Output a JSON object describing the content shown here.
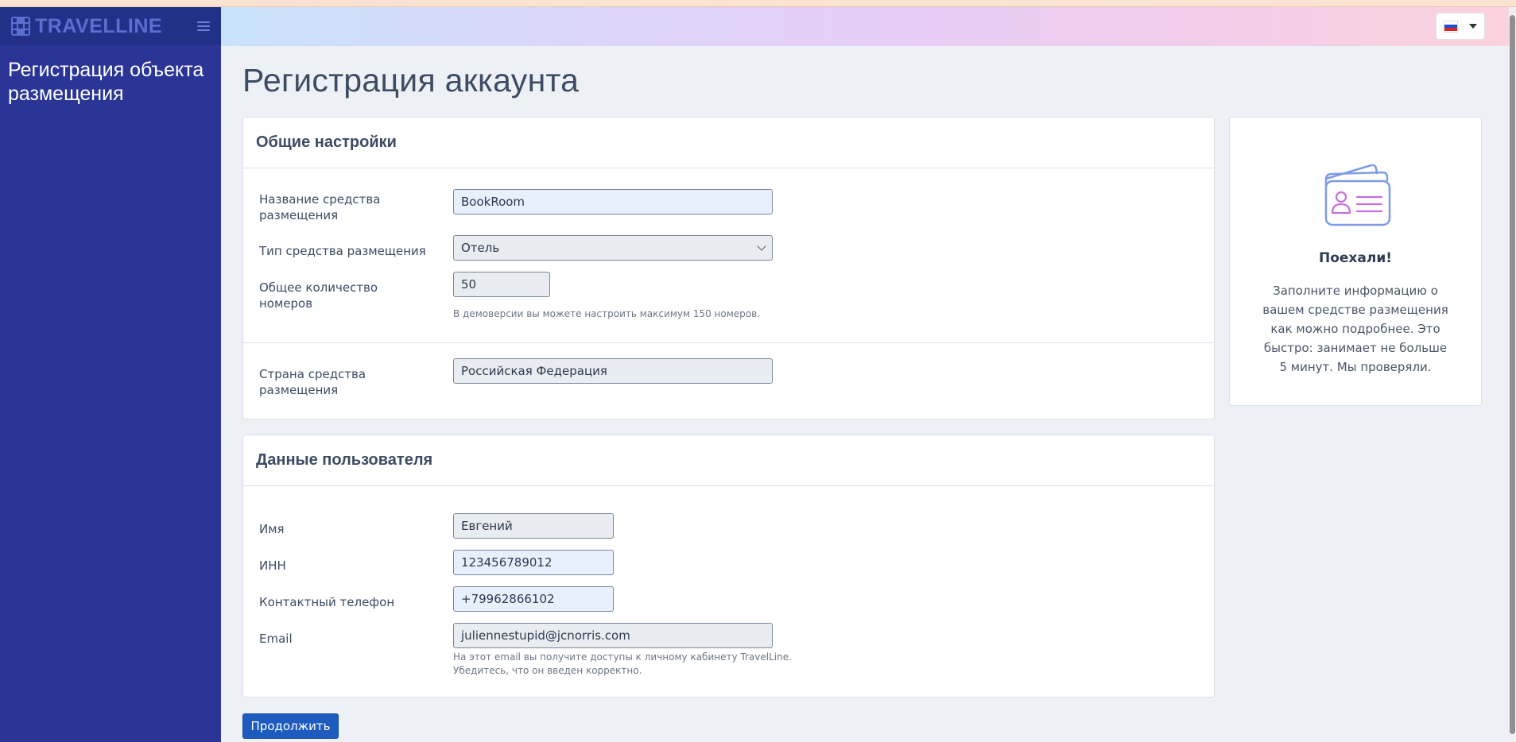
{
  "app": {
    "brand": "TRAVELLINE",
    "sidebar_title": "Регистрация объекта размещения",
    "language": "RU"
  },
  "page": {
    "title": "Регистрация аккаунта"
  },
  "general_settings": {
    "heading": "Общие настройки",
    "property_name_label": "Название средства размещения",
    "property_name_value": "BookRoom",
    "property_type_label": "Тип средства размещения",
    "property_type_value": "Отель",
    "rooms_label": "Общее количество номеров",
    "rooms_value": "50",
    "rooms_hint": "В демоверсии вы можете настроить максимум 150 номеров.",
    "country_label": "Страна средства размещения",
    "country_value": "Российская Федерация"
  },
  "user_data": {
    "heading": "Данные пользователя",
    "name_label": "Имя",
    "name_value": "Евгений",
    "inn_label": "ИНН",
    "inn_value": "123456789012",
    "phone_label": "Контактный телефон",
    "phone_value": "+79962866102",
    "email_label": "Email",
    "email_value": "juliennestupid@jcnorris.com",
    "email_hint_1": "На этот email вы получите доступы к личному кабинету TravelLine.",
    "email_hint_2": "Убедитесь, что он введен корректно."
  },
  "info_card": {
    "title": "Поехали!",
    "text": "Заполните информацию о вашем средстве размещения как можно подробнее. Это быстро: занимает не больше 5 минут. Мы проверяли.",
    "illustration_icon": "id-card-icon"
  },
  "actions": {
    "continue_label": "Продолжить"
  },
  "colors": {
    "sidebar": "#2b3596",
    "primary_button": "#1d5bbf",
    "field_background": "#e8f0fe"
  }
}
